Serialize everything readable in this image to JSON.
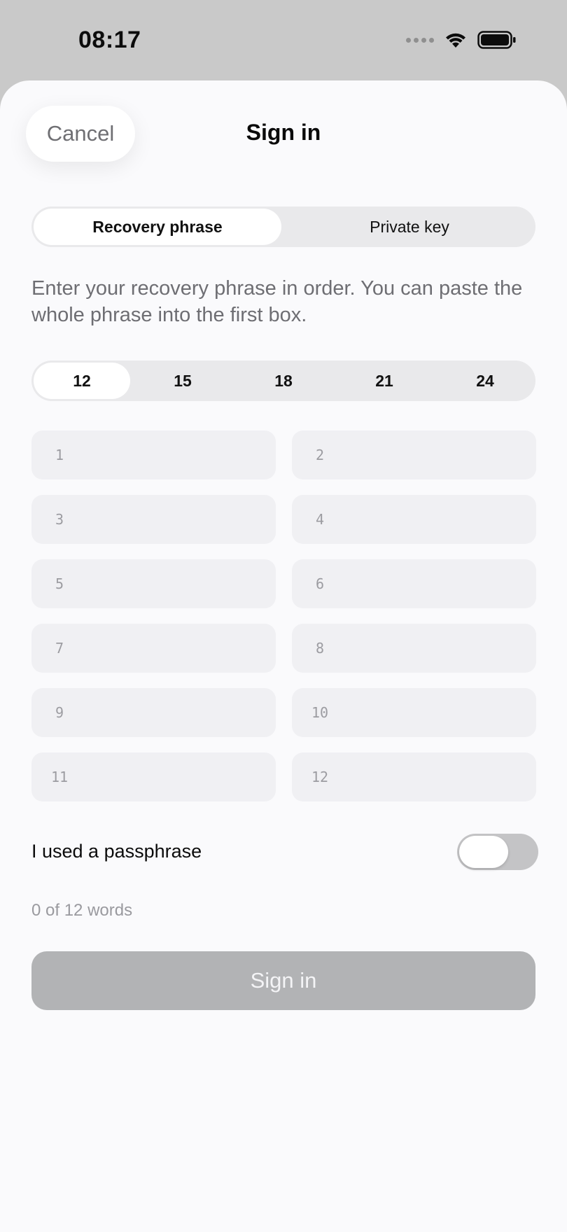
{
  "status_bar": {
    "time": "08:17",
    "icons": [
      "cellular-signal-icon",
      "wifi-icon",
      "battery-icon"
    ]
  },
  "header": {
    "cancel_label": "Cancel",
    "title": "Sign in"
  },
  "mode_tabs": [
    {
      "label": "Recovery phrase",
      "selected": true
    },
    {
      "label": "Private key",
      "selected": false
    }
  ],
  "instructions": "Enter your recovery phrase in order. You can paste the whole phrase into the first box.",
  "word_count_options": [
    {
      "label": "12",
      "selected": true
    },
    {
      "label": "15",
      "selected": false
    },
    {
      "label": "18",
      "selected": false
    },
    {
      "label": "21",
      "selected": false
    },
    {
      "label": "24",
      "selected": false
    }
  ],
  "word_fields": [
    {
      "index": "1",
      "value": ""
    },
    {
      "index": "2",
      "value": ""
    },
    {
      "index": "3",
      "value": ""
    },
    {
      "index": "4",
      "value": ""
    },
    {
      "index": "5",
      "value": ""
    },
    {
      "index": "6",
      "value": ""
    },
    {
      "index": "7",
      "value": ""
    },
    {
      "index": "8",
      "value": ""
    },
    {
      "index": "9",
      "value": ""
    },
    {
      "index": "10",
      "value": ""
    },
    {
      "index": "11",
      "value": ""
    },
    {
      "index": "12",
      "value": ""
    }
  ],
  "passphrase": {
    "label": "I used a passphrase",
    "enabled": false
  },
  "progress_text": "0 of 12 words",
  "submit": {
    "label": "Sign in",
    "enabled": false
  },
  "colors": {
    "sheet_background": "#fafafc",
    "backdrop": "#c9c9c9",
    "field_background": "#f0f0f3",
    "disabled_button": "#b2b3b5",
    "secondary_text": "#6e6e73"
  }
}
